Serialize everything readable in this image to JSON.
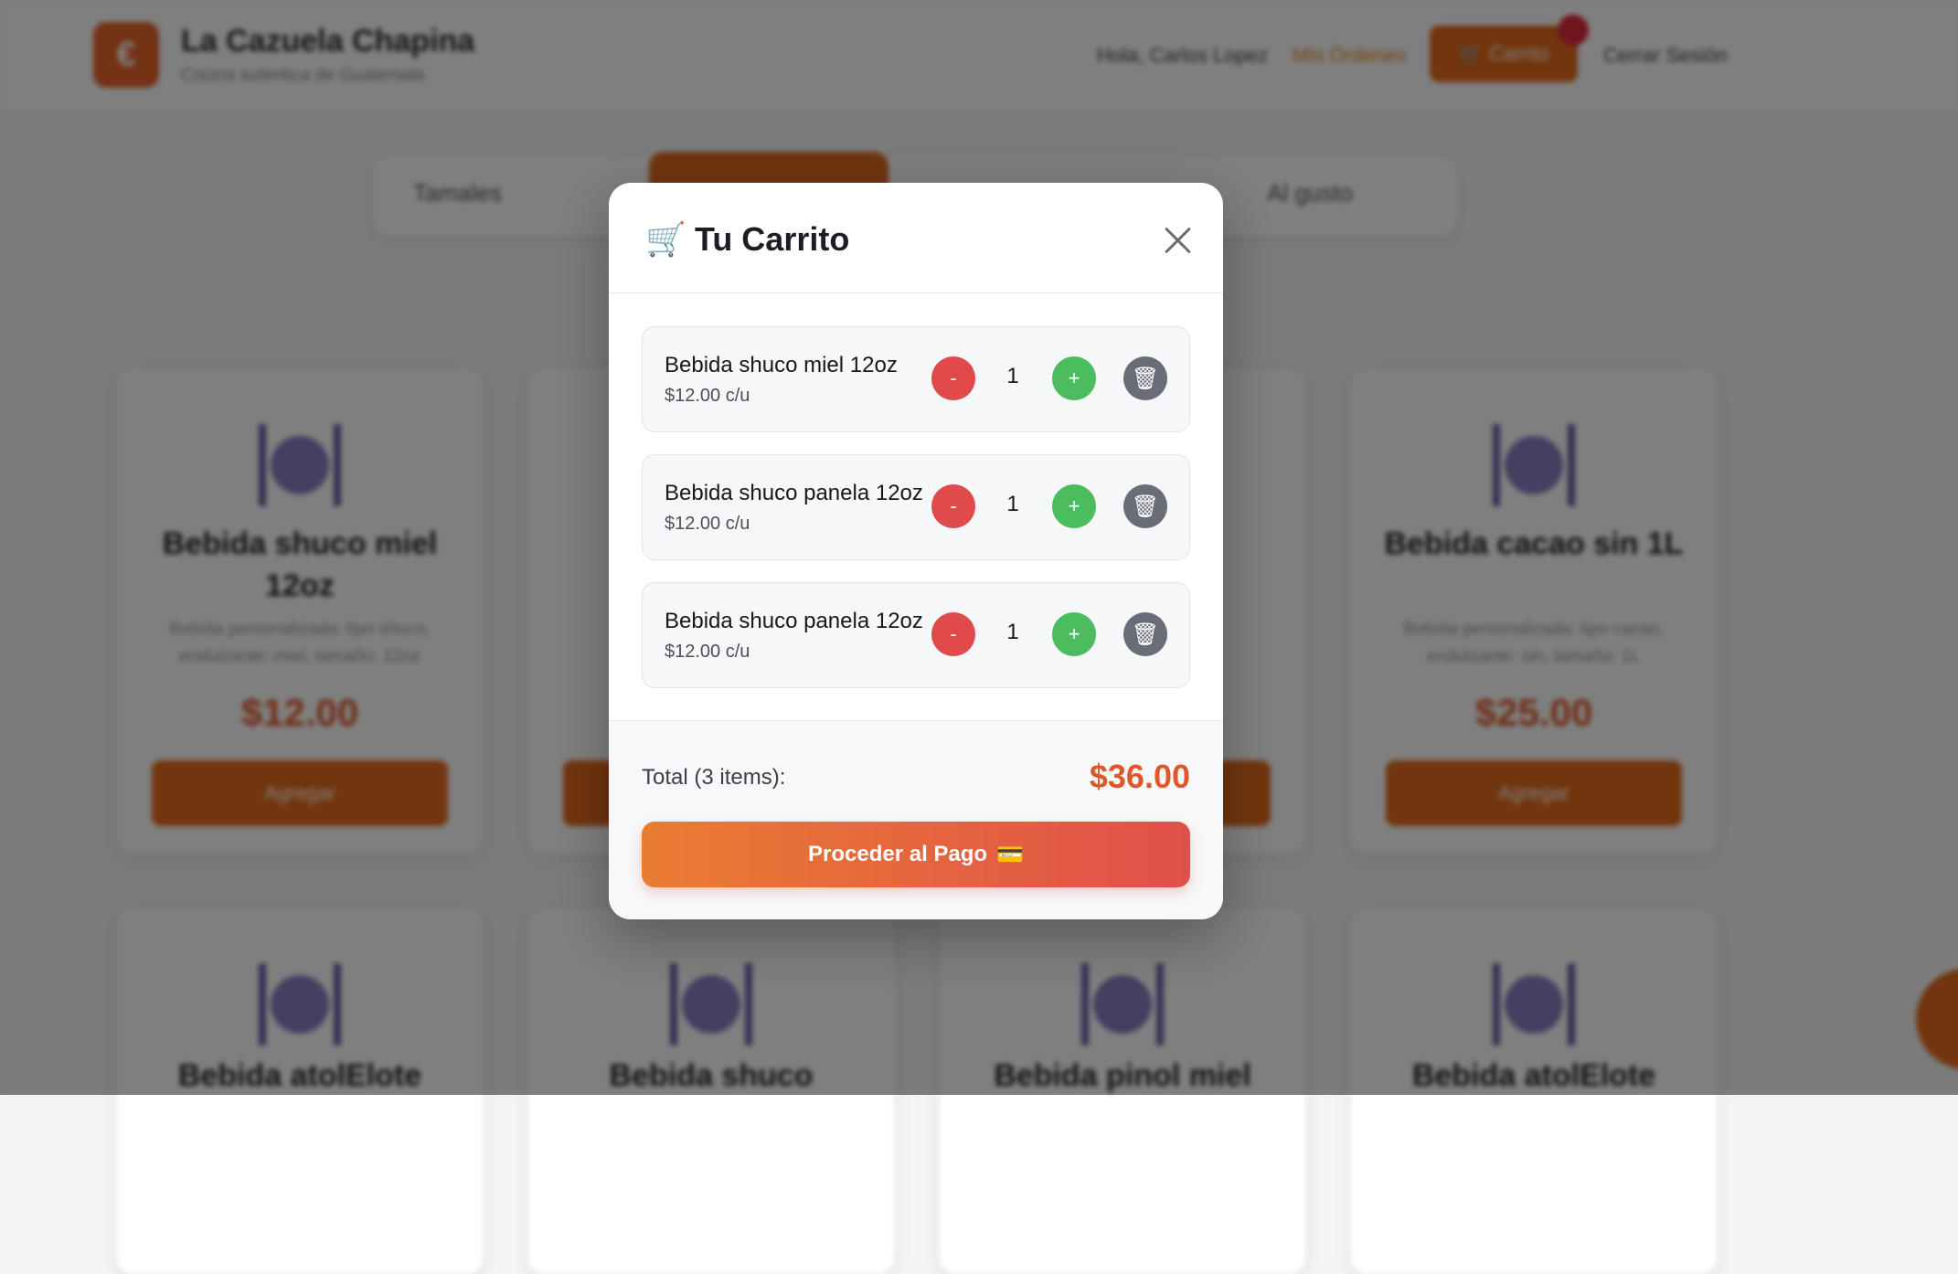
{
  "header": {
    "brand_initial": "€",
    "brand_name": "La Cazuela Chapina",
    "brand_tagline": "Cocina auténtica de Guatemala",
    "user_name": "Hola, Carlos Lopez",
    "orders_link": "Mis Órdenes",
    "cart_button": "🛒 Carrito",
    "logout": "Cerrar Sesión"
  },
  "categories": {
    "items": [
      "Tamales",
      "Al gusto"
    ]
  },
  "products": [
    {
      "title": "Bebida shuco miel 12oz",
      "desc": "Bebida personalizada: tipo shuco, endulzante: miel, tamaño: 12oz",
      "price": "$12.00",
      "button": "Agregar"
    },
    {
      "title": "Bebida cacao sin 1L",
      "desc": "Bebida personalizada: tipo cacao, endulzante: sin, tamaño: 1L",
      "price": "$25.00",
      "button": "Agregar"
    }
  ],
  "products_row2": [
    "Bebida atolElote",
    "Bebida shuco",
    "Bebida pinol miel",
    "Bebida atolElote"
  ],
  "cart_modal": {
    "icon": "🛒",
    "title": "Tu Carrito",
    "items": [
      {
        "name": "Bebida shuco miel 12oz",
        "unit_price": "$12.00 c/u",
        "quantity": "1",
        "minus": "-",
        "plus": "+",
        "trash": "🗑"
      },
      {
        "name": "Bebida shuco panela 12oz",
        "unit_price": "$12.00 c/u",
        "quantity": "1",
        "minus": "-",
        "plus": "+",
        "trash": "🗑"
      },
      {
        "name": "Bebida shuco panela 12oz",
        "unit_price": "$12.00 c/u",
        "quantity": "1",
        "minus": "-",
        "plus": "+",
        "trash": "🗑"
      }
    ],
    "total_label": "Total (3 items):",
    "total_value": "$36.00",
    "checkout_label": "Proceder al Pago",
    "checkout_icon": "💳"
  },
  "colors": {
    "accent": "#e46b1c",
    "price": "#e0582a",
    "minus": "#e04a4a",
    "plus": "#4cbd5e",
    "trash": "#6a6d78"
  }
}
